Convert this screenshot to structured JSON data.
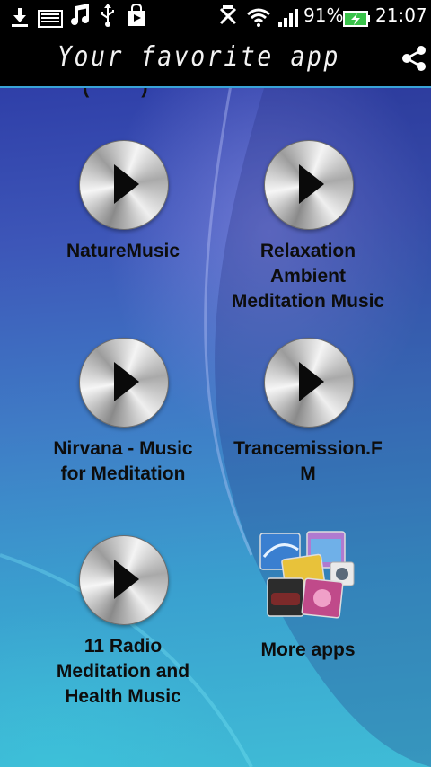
{
  "status_bar": {
    "battery_percent": "91%",
    "time": "21:07",
    "icons": [
      "download-icon",
      "keyboard-icon",
      "music-note-icon",
      "usb-icon",
      "shopping-bag-icon",
      "mute-icon",
      "wifi-icon",
      "signal-icon",
      "battery-icon"
    ]
  },
  "title_bar": {
    "title": "Your favorite app",
    "share_icon": "share-icon"
  },
  "tiles": [
    {
      "label": "NatureMusic",
      "icon": "play-icon"
    },
    {
      "label": "Relaxation Ambient Meditation Music",
      "icon": "play-icon"
    },
    {
      "label": "Nirvana - Music for Meditation",
      "icon": "play-icon"
    },
    {
      "label": "Trancemission.FM",
      "icon": "play-icon"
    },
    {
      "label": "11 Radio Meditation and Health Music",
      "icon": "play-icon"
    },
    {
      "label": "More apps",
      "icon": "app-collage-icon"
    }
  ],
  "colors": {
    "accent_line": "#39a3d8",
    "title_bar": "#000000",
    "label_text": "#0d0d0d"
  }
}
